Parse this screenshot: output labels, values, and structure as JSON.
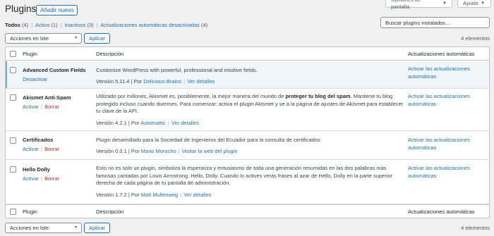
{
  "header": {
    "title": "Plugins",
    "add_new": "Añadir nuevo",
    "screen_options": "Opciones de pantalla",
    "help": "Ayuda"
  },
  "filters": {
    "all_label": "Todos",
    "all_count": "(4)",
    "active_label": "Activo",
    "active_count": "(1)",
    "inactive_label": "Inactivos",
    "inactive_count": "(3)",
    "autoupdate_off_label": "Actualizaciones automáticas desactivadas",
    "autoupdate_off_count": "(4)"
  },
  "search": {
    "placeholder": "Buscar plugins instalados..."
  },
  "bulk": {
    "select_value": "Acciones en lote",
    "apply": "Aplicar",
    "count": "4 elementos"
  },
  "table": {
    "columns": {
      "plugin": "Plugin",
      "description": "Descripción",
      "auto_updates": "Actualizaciones automáticas"
    },
    "rows": [
      {
        "name": "Advanced Custom Fields",
        "action1": "Desactivar",
        "description": "Customize WordPress with powerful, professional and intuitive fields.",
        "version": "Versión 5.11.4",
        "by": "| Por",
        "author": "Delicious Brains",
        "details": "Ver detalles",
        "auto": "Activar las actualizaciones automáticas"
      },
      {
        "name": "Akismet Anti-Spam",
        "action1": "Activar",
        "action2": "Borrar",
        "description_pre": "Utilizado por millones, Akismet es, posiblemente, la mejor manera del mundo de ",
        "description_bold": "proteger tu blog del spam",
        "description_post": ". Mantiene tu blog protegido incluso cuando duermes. Para comenzar: activa el plugin Akismet y ve a la página de ajustes de Akismet para establecer tu clave de la API.",
        "version": "Versión 4.2.1",
        "by": "| Por",
        "author": "Automattic",
        "details": "Ver detalles",
        "auto": "Activar las actualizaciones automáticas"
      },
      {
        "name": "Certificados",
        "action1": "Activar",
        "action2": "Borrar",
        "description": "Plugin desarrollado para la Sociedad de Ingenieros del Ecuador para la consulta de certificados",
        "version": "Versión 0.0.1",
        "by": "| Por",
        "author": "Mario Morocho",
        "details": "Visitar la web del plugin",
        "auto": "Activar las actualizaciones automáticas"
      },
      {
        "name": "Hello Dolly",
        "action1": "Activar",
        "action2": "Borrar",
        "description": "Esto no es solo un plugin, simboliza la esperanza y entusiasmo de toda una generación resumidas en las dos palabras más famosas cantadas por Louis Armstrong: Hello, Dolly. Cuando lo actives verás frases al azar de Hello, Dolly en la parte superior derecha de cada página de tu pantalla de administración.",
        "version": "Versión 1.7.2",
        "by": "| Por",
        "author": "Matt Mullenweg",
        "details": "Ver detalles",
        "auto": "Activar las actualizaciones automáticas"
      }
    ]
  },
  "colors": {
    "link": "#2271b1",
    "delete": "#b32d2e",
    "active_row_bg": "#f0f6fc",
    "active_row_border": "#72aee6"
  }
}
